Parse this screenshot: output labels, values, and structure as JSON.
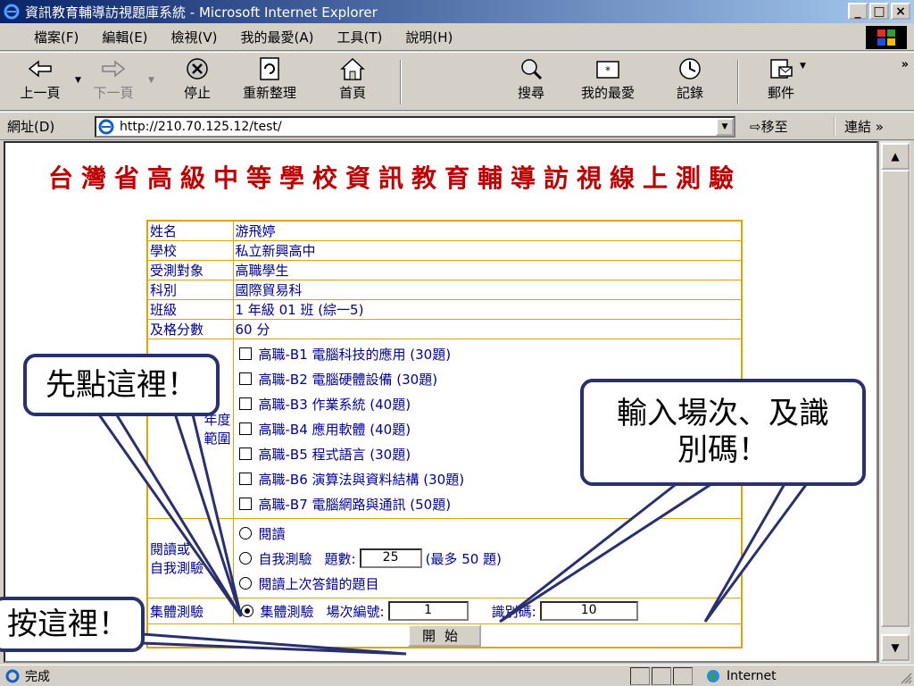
{
  "window": {
    "title": "資訊教育輔導訪視題庫系統 - Microsoft Internet Explorer",
    "minimize": "_",
    "maximize": "□",
    "close": "×"
  },
  "menu": {
    "items": [
      "檔案(F)",
      "編輯(E)",
      "檢視(V)",
      "我的最愛(A)",
      "工具(T)",
      "說明(H)"
    ]
  },
  "toolbar": {
    "back": "上一頁",
    "forward": "下一頁",
    "stop": "停止",
    "refresh": "重新整理",
    "home": "首頁",
    "search": "搜尋",
    "favorites": "我的最愛",
    "history": "記錄",
    "mail": "郵件",
    "more": "»"
  },
  "address": {
    "label": "網址(D)",
    "url": "http://210.70.125.12/test/",
    "go": "移至",
    "links": "連結 »"
  },
  "page": {
    "title": "台灣省高級中等學校資訊教育輔導訪視線上測驗",
    "labels": {
      "name": "姓名",
      "school": "學校",
      "target": "受測對象",
      "dept": "科別",
      "class": "班級",
      "pass": "及格分數",
      "scope": "年度\n範圍",
      "mode": "閱讀或\n自我測驗",
      "group": "集體測驗"
    },
    "values": {
      "name": "游飛婷",
      "school": "私立新興高中",
      "target": "高職學生",
      "dept": "國際貿易科",
      "class": "1 年級 01 班 (綜一5)",
      "pass": "60 分"
    },
    "subjects": [
      "高職-B1 電腦科技的應用 (30題)",
      "高職-B2 電腦硬體設備 (30題)",
      "高職-B3 作業系統 (40題)",
      "高職-B4 應用軟體 (40題)",
      "高職-B5 程式語言 (30題)",
      "高職-B6 演算法與資料結構 (30題)",
      "高職-B7 電腦網路與通訊 (50題)"
    ],
    "read": "閱讀",
    "self_test": "自我測驗",
    "count_label": "題數:",
    "count_value": "25",
    "count_max": "(最多 50 題)",
    "read_wrong": "閱讀上次答錯的題目",
    "group_test": "集體測驗",
    "session_label": "場次編號:",
    "session_value": "1",
    "code_label": "識別碼:",
    "code_value": "10",
    "start": "開始"
  },
  "callouts": {
    "first": "先點這裡！",
    "input": "輸入場次、及識別碼！",
    "press": "按這裡！"
  },
  "status": {
    "text": "完成",
    "zone": "Internet"
  },
  "colors": {
    "title_red": "#c00000",
    "table_border": "#e8a000",
    "table_text": "#000099",
    "callout_border": "#283070"
  }
}
